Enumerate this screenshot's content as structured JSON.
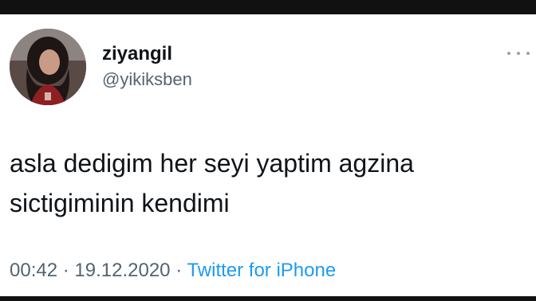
{
  "tweet": {
    "display_name": "ziyangil",
    "handle": "@yikiksben",
    "text": "asla dedigim her seyi yaptim agzina\nsictigiminin kendimi",
    "time": "00:42",
    "separator": "·",
    "date": "19.12.2020",
    "source": "Twitter for iPhone"
  },
  "icons": {
    "more": "more-dots-icon",
    "avatar": "avatar-image"
  },
  "colors": {
    "name": "#0f1419",
    "secondary": "#536471",
    "link": "#1d9bf0",
    "background": "#ffffff"
  }
}
